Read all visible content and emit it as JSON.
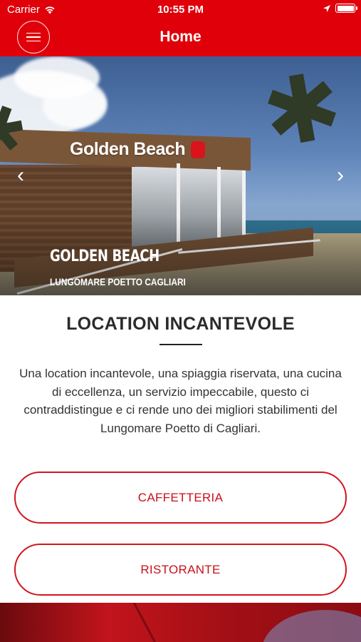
{
  "status_bar": {
    "carrier": "Carrier",
    "time": "10:55 PM"
  },
  "nav": {
    "title": "Home",
    "menu_icon": "hamburger-menu-icon"
  },
  "hero": {
    "logo_text": "Golden Beach",
    "title": "GOLDEN BEACH",
    "subtitle": "LUNGOMARE POETTO CAGLIARI",
    "prev_arrow": "‹",
    "next_arrow": "›"
  },
  "section": {
    "title": "LOCATION INCANTEVOLE",
    "description": "Una location incantevole, una spiaggia riservata, una cucina di eccellenza, un servizio impeccabile, questo ci contraddistingue e ci rende uno dei migliori stabilimenti del Lungomare  Poetto di Cagliari."
  },
  "buttons": [
    {
      "label": "CAFFETTERIA"
    },
    {
      "label": "RISTORANTE"
    }
  ],
  "colors": {
    "brand_red": "#e0000a",
    "button_border": "#d2151e",
    "button_text": "#c8101a"
  }
}
